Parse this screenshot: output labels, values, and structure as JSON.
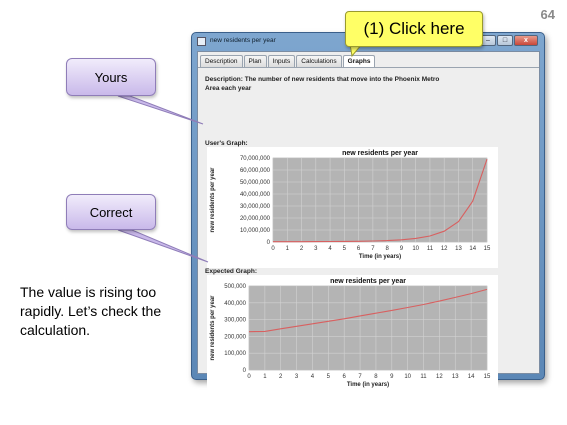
{
  "slide_number": "64",
  "window": {
    "title": "new residents per year",
    "minimize": "–",
    "maximize": "□",
    "close": "x"
  },
  "tabs": [
    {
      "label": "Description",
      "active": false
    },
    {
      "label": "Plan",
      "active": false
    },
    {
      "label": "Inputs",
      "active": false
    },
    {
      "label": "Calculations",
      "active": false
    },
    {
      "label": "Graphs",
      "active": true
    }
  ],
  "description_lines": [
    "Description: The number of new residents that move into the Phoenix Metro",
    "Area each year"
  ],
  "users_graph_label": "User's Graph:",
  "expected_graph_label": "Expected Graph:",
  "callouts": {
    "click_here": "(1) Click here",
    "yours": "Yours",
    "correct": "Correct"
  },
  "note": "The value is rising too rapidly.  Let’s check the calculation.",
  "chart_data": [
    {
      "type": "line",
      "title": "new residents per year",
      "xlabel": "Time (in years)",
      "ylabel": "new residents per year",
      "xlim": [
        0,
        15
      ],
      "ylim": [
        0,
        70000000
      ],
      "x_ticks": [
        "0",
        "1",
        "2",
        "3",
        "4",
        "5",
        "6",
        "7",
        "8",
        "9",
        "10",
        "11",
        "12",
        "13",
        "14",
        "15"
      ],
      "y_ticks": [
        "0",
        "10,000,000",
        "20,000,000",
        "30,000,000",
        "40,000,000",
        "50,000,000",
        "60,000,000",
        "70,000,000"
      ],
      "y_tick_values": [
        0,
        10000000,
        20000000,
        30000000,
        40000000,
        50000000,
        60000000,
        70000000
      ],
      "grid": true,
      "line_color": "#d86060",
      "plot_bg": "#b4b4b4",
      "x": [
        0,
        1,
        2,
        3,
        4,
        5,
        6,
        7,
        8,
        9,
        10,
        11,
        12,
        13,
        14,
        15
      ],
      "values": [
        230000,
        250000,
        280000,
        320000,
        380000,
        470000,
        600000,
        800000,
        1200000,
        1800000,
        3000000,
        5000000,
        9000000,
        17000000,
        34000000,
        69000000
      ]
    },
    {
      "type": "line",
      "title": "new residents per year",
      "xlabel": "Time (in years)",
      "ylabel": "new residents per year",
      "xlim": [
        0,
        15
      ],
      "ylim": [
        0,
        500000
      ],
      "x_ticks": [
        "0",
        "1",
        "2",
        "3",
        "4",
        "5",
        "6",
        "7",
        "8",
        "9",
        "10",
        "11",
        "12",
        "13",
        "14",
        "15"
      ],
      "y_ticks": [
        "0",
        "100,000",
        "200,000",
        "300,000",
        "400,000",
        "500,000"
      ],
      "y_tick_values": [
        0,
        100000,
        200000,
        300000,
        400000,
        500000
      ],
      "grid": true,
      "line_color": "#d86060",
      "plot_bg": "#b4b4b4",
      "x": [
        0,
        1,
        2,
        3,
        4,
        5,
        6,
        7,
        8,
        9,
        10,
        11,
        12,
        13,
        14,
        15
      ],
      "values": [
        228000,
        230000,
        245000,
        260000,
        275000,
        290000,
        305000,
        322000,
        338000,
        355000,
        372000,
        390000,
        410000,
        432000,
        455000,
        480000
      ]
    }
  ]
}
